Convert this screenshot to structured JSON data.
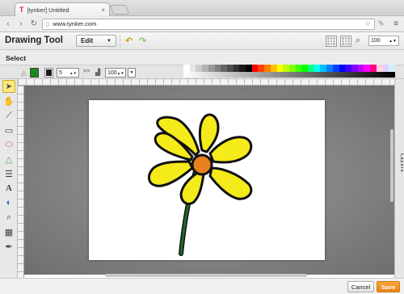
{
  "browser": {
    "tab_title": "[tynker] Untitled",
    "url": "www.tynker.com"
  },
  "app": {
    "title": "Drawing Tool",
    "edit_menu": "Edit",
    "zoom_value": "100"
  },
  "select_label": "Select",
  "tool_options": {
    "stroke_width": "5",
    "opacity": "100",
    "more": ">>",
    "stroke_color": "#1a1a1a",
    "fill_color": "#1a8a1a"
  },
  "palette_colors": [
    "#ffffff",
    "#e6e6e6",
    "#cccccc",
    "#b3b3b3",
    "#999999",
    "#808080",
    "#666666",
    "#4d4d4d",
    "#333333",
    "#1a1a1a",
    "#000000",
    "#ff0000",
    "#ff4000",
    "#ff8000",
    "#ffbf00",
    "#ffff00",
    "#bfff00",
    "#80ff00",
    "#40ff00",
    "#00ff00",
    "#00ff80",
    "#00ffff",
    "#00bfff",
    "#0080ff",
    "#0040ff",
    "#0000ff",
    "#4000ff",
    "#8000ff",
    "#bf00ff",
    "#ff00ff",
    "#ff0080",
    "#ffd0e0",
    "#e0d0ff",
    "#d0f0ff"
  ],
  "tools": [
    {
      "name": "select-tool",
      "icon": "arrow-pointer-icon"
    },
    {
      "name": "pan-tool",
      "icon": "hand-icon"
    },
    {
      "name": "pen-tool",
      "icon": "pencil-icon"
    },
    {
      "name": "path-tool",
      "icon": "bezier-icon"
    },
    {
      "name": "rect-tool",
      "icon": "rectangle-icon"
    },
    {
      "name": "ellipse-tool",
      "icon": "ellipse-icon"
    },
    {
      "name": "triangle-tool",
      "icon": "triangle-icon"
    },
    {
      "name": "stack-tool",
      "icon": "stack-icon"
    },
    {
      "name": "text-tool",
      "icon": "text-icon"
    },
    {
      "name": "fill-tool",
      "icon": "bucket-icon"
    },
    {
      "name": "zoom-tool",
      "icon": "magnifier-icon"
    },
    {
      "name": "grid-tool",
      "icon": "grid-icon"
    },
    {
      "name": "eyedropper-tool",
      "icon": "eyedropper-icon"
    }
  ],
  "layers_label": "Layers",
  "footer": {
    "cancel_label": "Cancel",
    "save_label": "Save"
  },
  "drawing": {
    "petal_color": "#f5ea1a",
    "center_color": "#e8801e",
    "stem_color": "#1e6b2a",
    "outline_color": "#111111"
  }
}
